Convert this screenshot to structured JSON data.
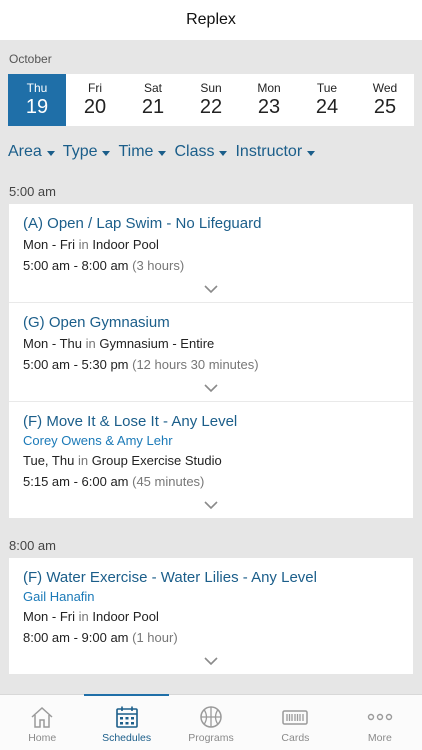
{
  "header": {
    "title": "Replex"
  },
  "calendar": {
    "month": "October",
    "days": [
      {
        "name": "Thu",
        "date": "19",
        "selected": true
      },
      {
        "name": "Fri",
        "date": "20"
      },
      {
        "name": "Sat",
        "date": "21"
      },
      {
        "name": "Sun",
        "date": "22"
      },
      {
        "name": "Mon",
        "date": "23"
      },
      {
        "name": "Tue",
        "date": "24"
      },
      {
        "name": "Wed",
        "date": "25"
      }
    ],
    "selected_color": "#1f6fa8"
  },
  "filters": [
    "Area",
    "Type",
    "Time",
    "Class",
    "Instructor"
  ],
  "sections": [
    {
      "time": "5:00 am",
      "items": [
        {
          "name": "(A) Open / Lap Swim - No Lifeguard",
          "days": "Mon - Fri",
          "in": "in",
          "location": "Indoor Pool",
          "hours": "5:00 am - 8:00 am",
          "duration": "(3 hours)"
        },
        {
          "name": "(G) Open Gymnasium",
          "days": "Mon - Thu",
          "in": "in",
          "location": "Gymnasium - Entire",
          "hours": "5:00 am - 5:30 pm",
          "duration": "(12 hours 30 minutes)"
        },
        {
          "name": "(F) Move It & Lose It - Any Level",
          "instructor": "Corey Owens & Amy Lehr",
          "days": "Tue, Thu",
          "in": "in",
          "location": "Group Exercise Studio",
          "hours": "5:15 am - 6:00 am",
          "duration": "(45 minutes)"
        }
      ]
    },
    {
      "time": "8:00 am",
      "items": [
        {
          "name": "(F) Water Exercise - Water Lilies - Any Level",
          "instructor": "Gail Hanafin",
          "days": "Mon - Fri",
          "in": "in",
          "location": "Indoor Pool",
          "hours": "8:00 am - 9:00 am",
          "duration": "(1 hour)"
        }
      ]
    }
  ],
  "tabs": [
    {
      "label": "Home",
      "icon": "home-icon"
    },
    {
      "label": "Schedules",
      "icon": "calendar-icon",
      "active": true
    },
    {
      "label": "Programs",
      "icon": "basketball-icon"
    },
    {
      "label": "Cards",
      "icon": "card-icon"
    },
    {
      "label": "More",
      "icon": "more-icon"
    }
  ]
}
